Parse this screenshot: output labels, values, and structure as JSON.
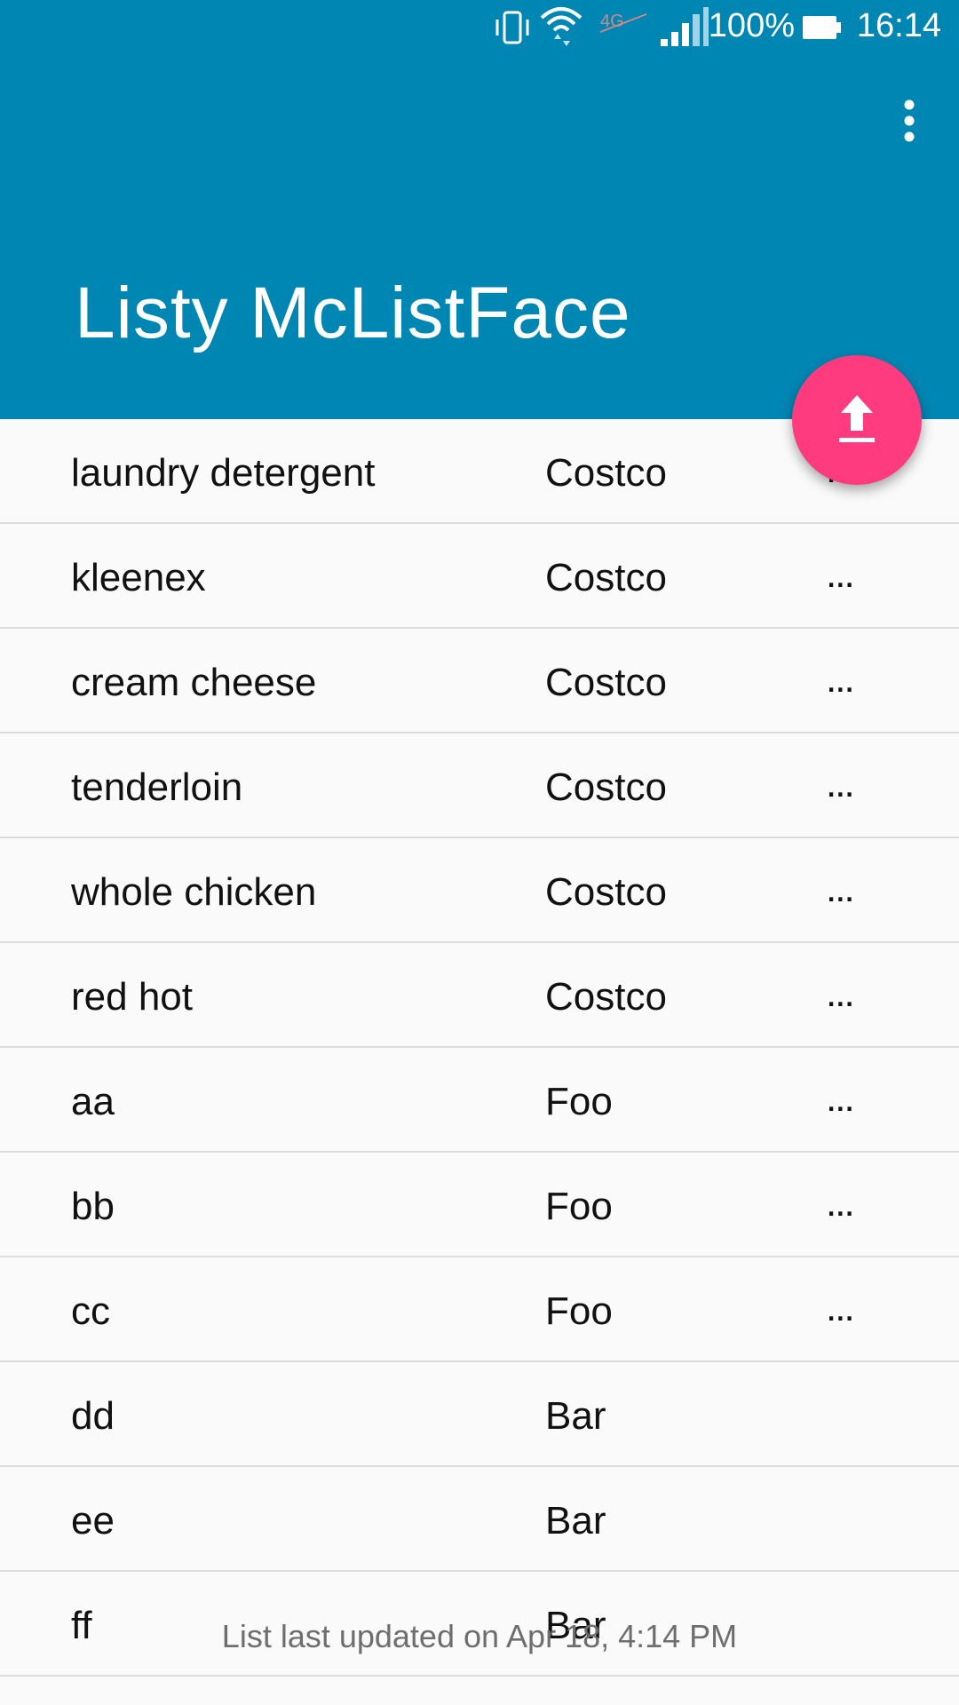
{
  "status_bar": {
    "battery_percent": "100%",
    "time": "16:14",
    "icons": [
      "vibrate-icon",
      "wifi-icon",
      "lte-icon",
      "signal-icon",
      "battery-icon"
    ]
  },
  "app_bar": {
    "title": "Listy McListFace",
    "background_color": "#0086b3",
    "overflow_icon": "more-vert-icon"
  },
  "fab": {
    "icon": "upload-icon",
    "color": "#ff3b7f"
  },
  "items": [
    {
      "name": "laundry detergent",
      "store": "Costco",
      "more": "..."
    },
    {
      "name": "kleenex",
      "store": "Costco",
      "more": "..."
    },
    {
      "name": "cream cheese",
      "store": "Costco",
      "more": "..."
    },
    {
      "name": "tenderloin",
      "store": "Costco",
      "more": "..."
    },
    {
      "name": "whole chicken",
      "store": "Costco",
      "more": "..."
    },
    {
      "name": "red hot",
      "store": "Costco",
      "more": "..."
    },
    {
      "name": "aa",
      "store": "Foo",
      "more": "..."
    },
    {
      "name": "bb",
      "store": "Foo",
      "more": "..."
    },
    {
      "name": "cc",
      "store": "Foo",
      "more": "..."
    },
    {
      "name": "dd",
      "store": "Bar",
      "more": ""
    },
    {
      "name": "ee",
      "store": "Bar",
      "more": ""
    },
    {
      "name": "ff",
      "store": "Bar",
      "more": ""
    }
  ],
  "footer": {
    "text": "List last updated on Apr 18, 4:14 PM"
  }
}
